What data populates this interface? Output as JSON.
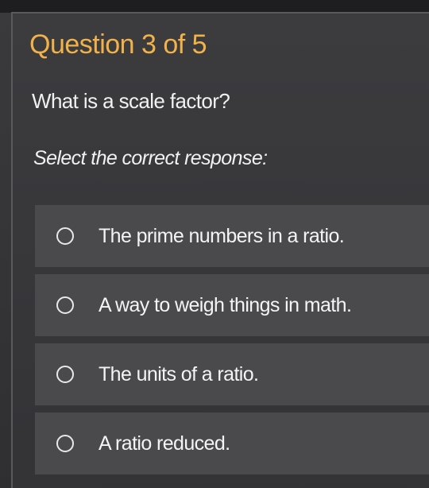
{
  "quiz": {
    "progress_label": "Question 3 of 5",
    "question": "What is a scale factor?",
    "instruction": "Select the correct response:",
    "options": [
      {
        "label": "The prime numbers in a ratio.",
        "selected": false
      },
      {
        "label": "A way to weigh things in math.",
        "selected": false
      },
      {
        "label": "The units of a ratio.",
        "selected": false
      },
      {
        "label": "A ratio reduced.",
        "selected": false
      }
    ]
  },
  "colors": {
    "accent": "#f2b24a",
    "background": "#38383b",
    "option_background": "#4a4a4d",
    "text": "#f1f1f1"
  }
}
